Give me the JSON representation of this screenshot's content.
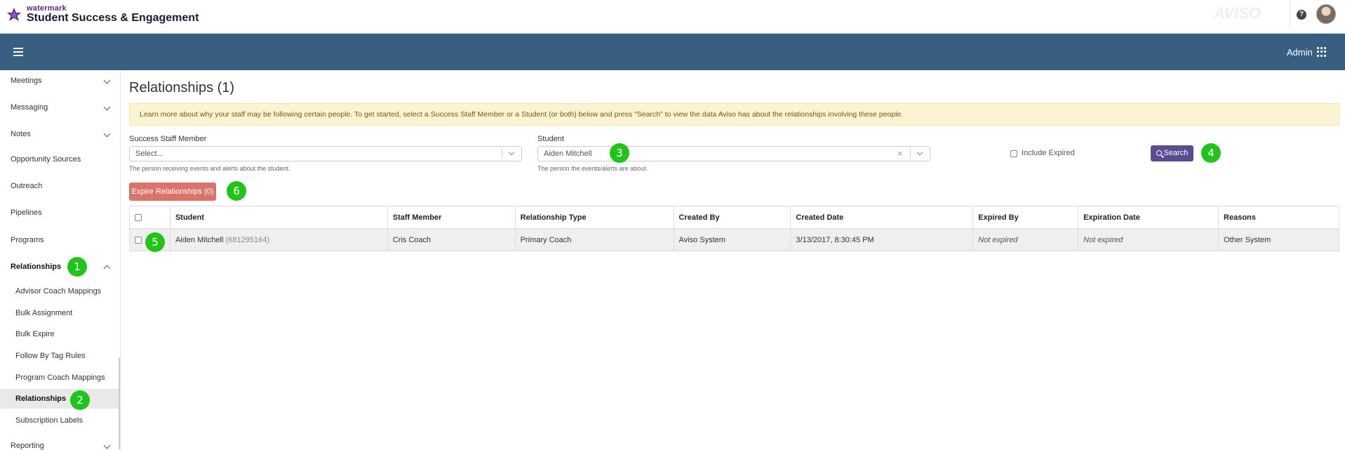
{
  "header": {
    "brand_small": "watermark",
    "brand_title": "Student Success & Engagement",
    "ghost_logo_text": "AVISO",
    "help_icon": "question-circle-icon",
    "avatar_icon": "user-avatar"
  },
  "navbar": {
    "menu_icon": "hamburger-icon",
    "admin_label": "Admin",
    "apps_icon": "grid-icon",
    "background": "#385f82"
  },
  "sidebar": {
    "items": [
      {
        "label": "Meetings"
      },
      {
        "label": "Messaging"
      },
      {
        "label": "Notes"
      },
      {
        "label": "Opportunity Sources"
      },
      {
        "label": "Outreach"
      },
      {
        "label": "Pipelines"
      },
      {
        "label": "Programs"
      },
      {
        "label": "Relationships"
      },
      {
        "label": "Reporting"
      }
    ],
    "sub_items": [
      {
        "label": "Advisor Coach Mappings"
      },
      {
        "label": "Bulk Assignment"
      },
      {
        "label": "Bulk Expire"
      },
      {
        "label": "Follow By Tag Rules"
      },
      {
        "label": "Program Coach Mappings"
      },
      {
        "label": "Relationships"
      },
      {
        "label": "Subscription Labels"
      }
    ]
  },
  "main": {
    "title": "Relationships (1)",
    "alert": "Learn more about why your staff may be following certain people. To get started, select a Success Staff Member or a Student (or both) below and press \"Search\" to view the data Aviso has about the relationships involving these people.",
    "staff": {
      "label": "Success Staff Member",
      "placeholder": "Select...",
      "helper": "The person receiving events and alerts about the student."
    },
    "student": {
      "label": "Student",
      "value": "Aiden Mitchell",
      "clear": "×",
      "helper": "The person the events/alerts are about."
    },
    "include_expired_label": "Include Expired",
    "search_label": "Search",
    "expire_button_label": "Expire Relationships (0)"
  },
  "markers": [
    "1",
    "2",
    "3",
    "4",
    "5",
    "6"
  ],
  "table": {
    "columns": [
      "Student",
      "Staff Member",
      "Relationship Type",
      "Created By",
      "Created Date",
      "Expired By",
      "Expiration Date",
      "Reasons"
    ],
    "rows": [
      {
        "student": "Aiden Mitchell",
        "student_id": "(681295164)",
        "staff": "Cris Coach",
        "type": "Primary Coach",
        "created_by": "Aviso System",
        "created_date": "3/13/2017, 8:30:45 PM",
        "expired_by": "Not expired",
        "expiration_date": "Not expired",
        "reasons": "Other System"
      }
    ]
  },
  "colors": {
    "accent_purple": "#5a4d8f",
    "danger": "#d9736b",
    "marker_green": "#22c41c",
    "alert_bg": "#fcf3d2"
  }
}
